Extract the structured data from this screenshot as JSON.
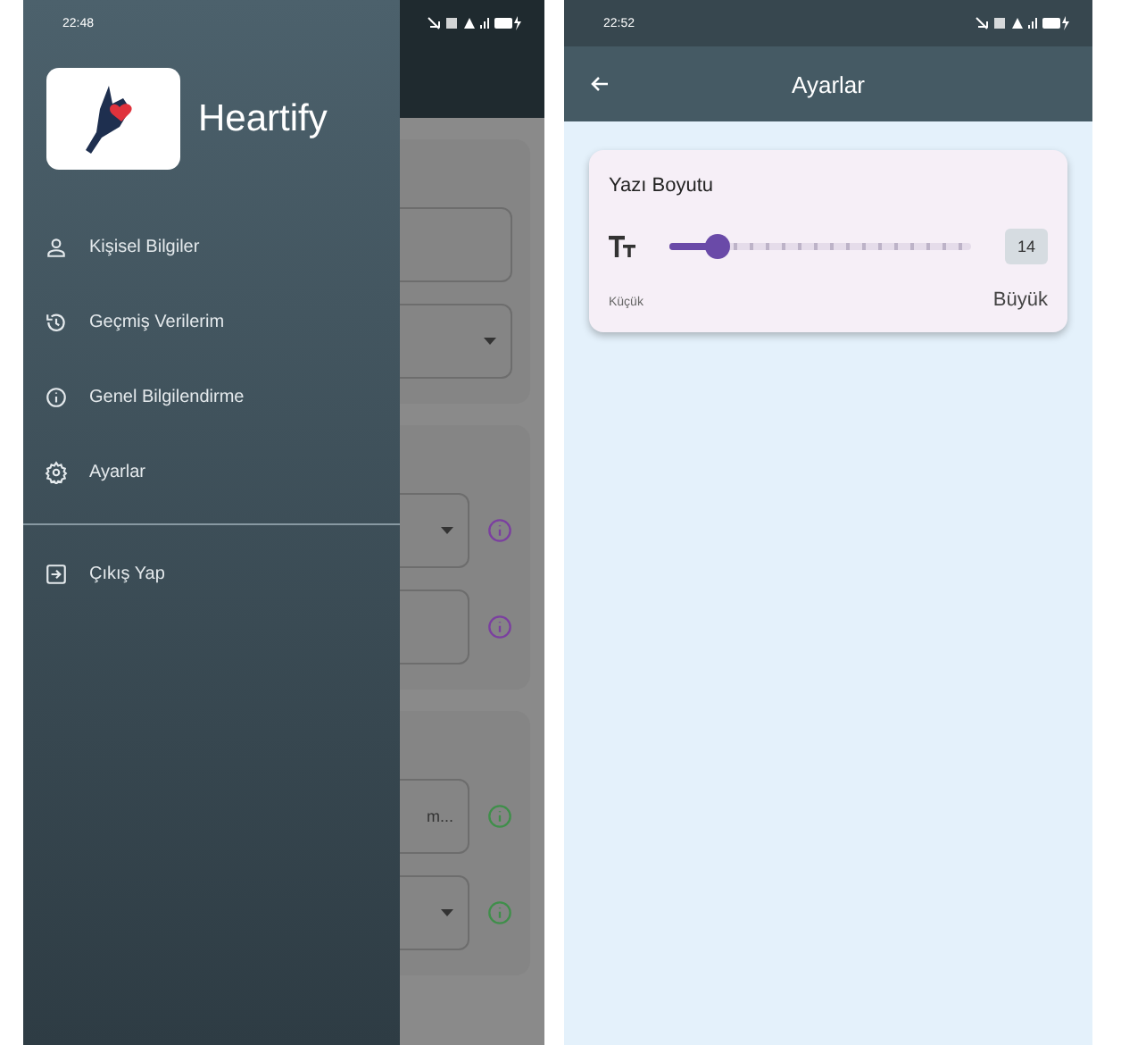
{
  "left_screen": {
    "status_bar": {
      "time": "22:48"
    },
    "drawer": {
      "app_name": "Heartify",
      "items": [
        {
          "label": "Kişisel Bilgiler"
        },
        {
          "label": "Geçmiş Verilerim"
        },
        {
          "label": "Genel Bilgilendirme"
        },
        {
          "label": "Ayarlar"
        }
      ],
      "footer_items": [
        {
          "label": "Çıkış Yap"
        }
      ]
    },
    "background_form": {
      "cards": [
        {
          "fields": [
            {
              "kind": "text"
            },
            {
              "kind": "dropdown"
            }
          ]
        },
        {
          "fields": [
            {
              "kind": "dropdown",
              "color": "#7b3fa0"
            },
            {
              "kind": "text",
              "color": "#7b3fa0"
            }
          ]
        },
        {
          "fields": [
            {
              "kind": "text",
              "value": "m...",
              "color": "#3f8f4a"
            },
            {
              "kind": "dropdown",
              "color": "#3f8f4a"
            }
          ]
        }
      ]
    }
  },
  "right_screen": {
    "status_bar": {
      "time": "22:52"
    },
    "app_bar": {
      "title": "Ayarlar"
    },
    "font_size_card": {
      "title": "Yazı Boyutu",
      "level": 0.16,
      "value": "14",
      "min_label": "Küçük",
      "max_label": "Büyük"
    }
  }
}
